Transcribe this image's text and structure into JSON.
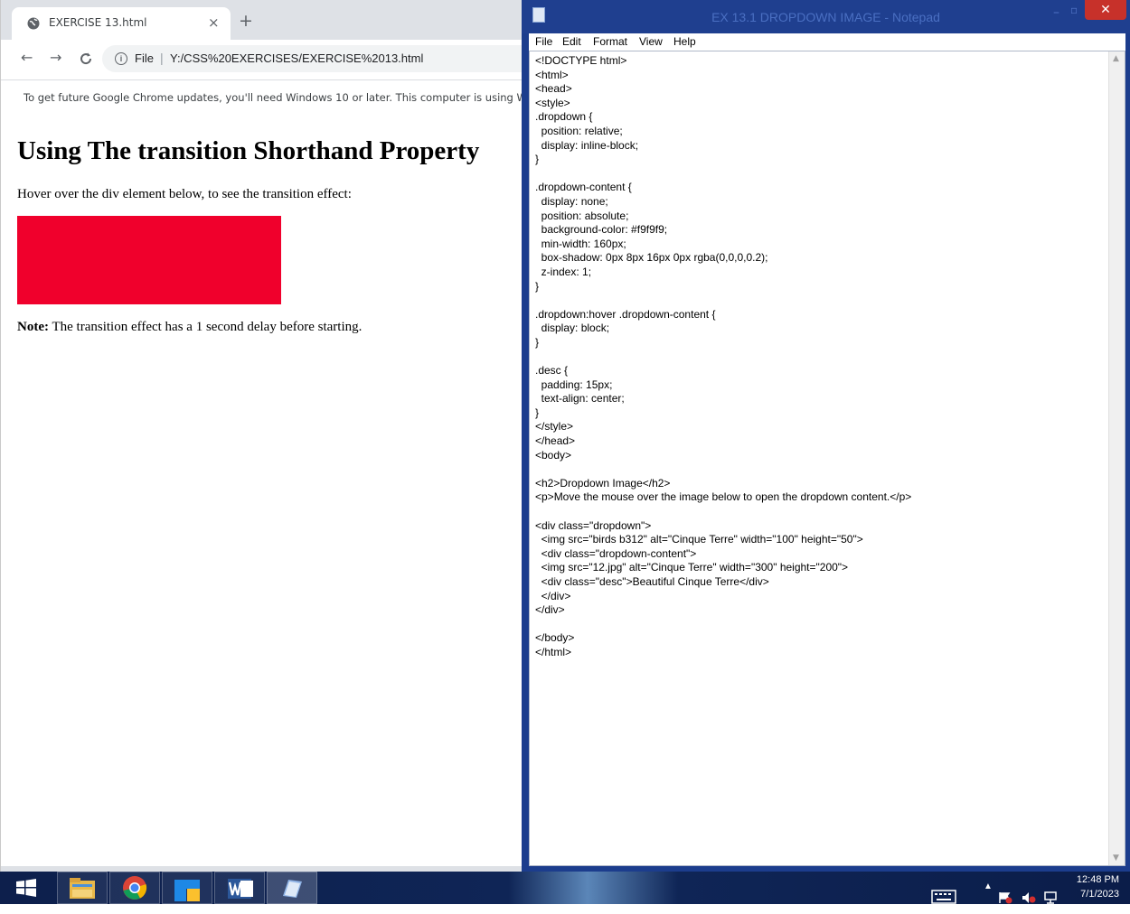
{
  "browser": {
    "tab_title": "EXERCISE 13.html",
    "tab_close_glyph": "×",
    "new_tab_glyph": "+",
    "url_scheme_label": "File",
    "url": "Y:/CSS%20EXERCISES/EXERCISE%2013.html",
    "infobar_text": "To get future Google Chrome updates, you'll need Windows 10 or later. This computer is using Win"
  },
  "page": {
    "heading": "Using The transition Shorthand Property",
    "instruction": "Hover over the div element below, to see the transition effect:",
    "box_color": "#f0002c",
    "note_label": "Note:",
    "note_text": " The transition effect has a 1 second delay before starting."
  },
  "notepad": {
    "title": "EX 13.1 DROPDOWN IMAGE - Notepad",
    "close_glyph": "✕",
    "menu": [
      "File",
      "Edit",
      "Format",
      "View",
      "Help"
    ],
    "code": "<!DOCTYPE html>\n<html>\n<head>\n<style>\n.dropdown {\n  position: relative;\n  display: inline-block;\n}\n\n.dropdown-content {\n  display: none;\n  position: absolute;\n  background-color: #f9f9f9;\n  min-width: 160px;\n  box-shadow: 0px 8px 16px 0px rgba(0,0,0,0.2);\n  z-index: 1;\n}\n\n.dropdown:hover .dropdown-content {\n  display: block;\n}\n\n.desc {\n  padding: 15px;\n  text-align: center;\n}\n</style>\n</head>\n<body>\n\n<h2>Dropdown Image</h2>\n<p>Move the mouse over the image below to open the dropdown content.</p>\n\n<div class=\"dropdown\">\n  <img src=\"birds b312\" alt=\"Cinque Terre\" width=\"100\" height=\"50\">\n  <div class=\"dropdown-content\">\n  <img src=\"12.jpg\" alt=\"Cinque Terre\" width=\"300\" height=\"200\">\n  <div class=\"desc\">Beautiful Cinque Terre</div>\n  </div>\n</div>\n\n</body>\n</html>"
  },
  "taskbar": {
    "apps": [
      "start-icon",
      "file-explorer-icon",
      "chrome-icon",
      "app-icon",
      "word-icon",
      "notepad-icon"
    ],
    "time": "12:48 PM",
    "date": "7/1/2023"
  }
}
